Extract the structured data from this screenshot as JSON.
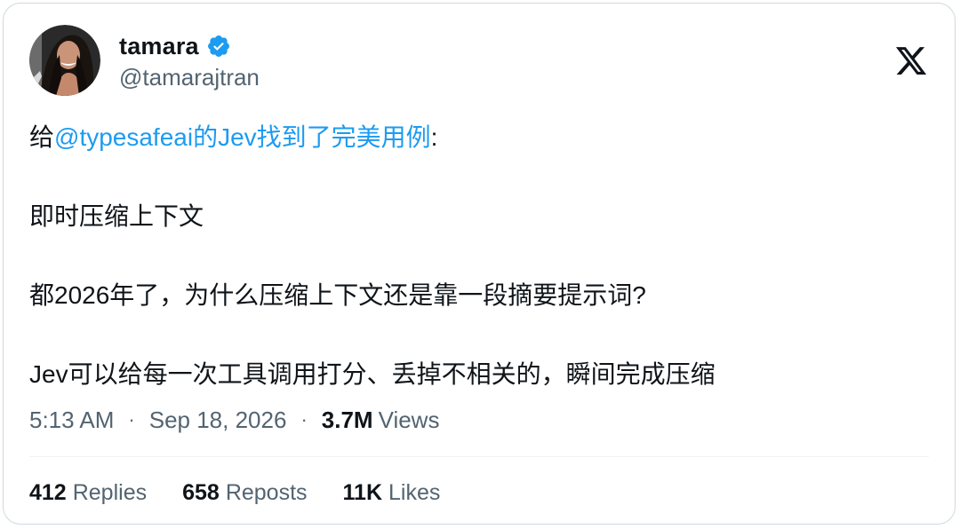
{
  "author": {
    "display_name": "tamara",
    "handle": "@tamarajtran",
    "verified_icon": "verified-badge-icon",
    "avatar": "avatar-photo"
  },
  "brand": {
    "logo_icon": "x-logo-icon",
    "accent_color": "#1d9bf0"
  },
  "tweet": {
    "line1_prefix": "给",
    "line1_mention": "@typesafeai的Jev找到了完美用例",
    "line1_suffix": ":",
    "line2": "即时压缩上下文",
    "line3": "都2026年了，为什么压缩上下文还是靠一段摘要提示词?",
    "line4": "Jev可以给每一次工具调用打分、丢掉不相关的，瞬间完成压缩"
  },
  "meta": {
    "time": "5:13 AM",
    "separator": "·",
    "date": "Sep 18, 2026",
    "views_count": "3.7M",
    "views_label": "Views"
  },
  "stats": {
    "replies_count": "412",
    "replies_label": "Replies",
    "reposts_count": "658",
    "reposts_label": "Reposts",
    "likes_count": "11K",
    "likes_label": "Likes"
  }
}
